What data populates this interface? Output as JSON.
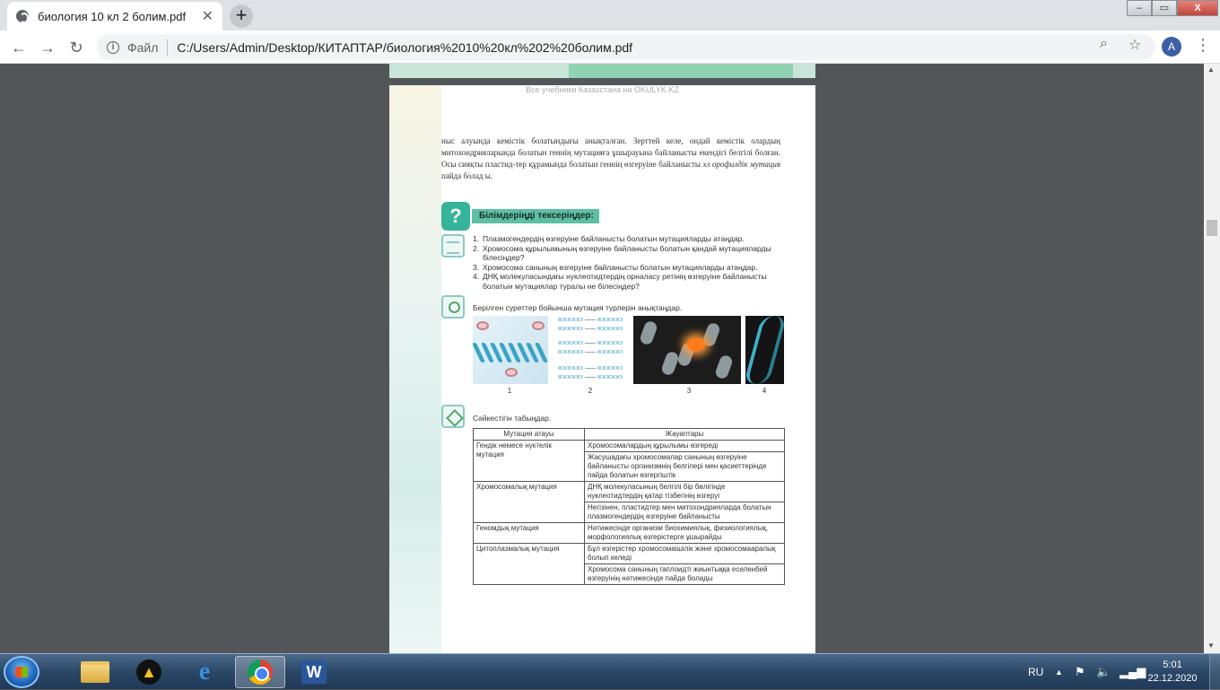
{
  "browser": {
    "tab_title": "биология 10 кл 2 болим.pdf",
    "tab_close": "✕",
    "new_tab": "+",
    "url_scheme": "Файл",
    "url": "C:/Users/Admin/Desktop/КИТАПТАР/биология%2010%20кл%202%20болим.pdf",
    "avatar_letter": "A",
    "window_controls": [
      "–",
      "▭",
      "X"
    ]
  },
  "pdf": {
    "watermark": "Все учебники Казахстана на OKULYK.KZ",
    "paragraph_part1": "ныс алуында кемістік болатындығы анықталған. Зерттей келе, ондай кемістік олардың митохондрияларында болатын геннің мутацияға ұшырауына байланысты екендігі белгілі болған. Осы сияқты пластид-тер құрамында болатын геннің өзгеруіне байланысты",
    "paragraph_italic": "хл орофилдік мутация",
    "paragraph_part2": "пайда болад ы.",
    "check_title": "Білімдеріңді тексеріңдер:",
    "questions": [
      {
        "num": "1.",
        "text": "Плазмогендердің өзгеруіне байланысты болатын мутацияларды атаңдар."
      },
      {
        "num": "2.",
        "text": "Хромосома құрылымының өзгеруіне байланысты болатын қандай мутацияларды білесіңдер?"
      },
      {
        "num": "3.",
        "text": "Хромосома санының өзгеруіне байланысты болатын мутацияларды атаңдар."
      },
      {
        "num": "4.",
        "text": "ДНҚ молекуласындағы нуклеотидтердің орналасу ретінің өзгеруіне байланысты болатын мутациялар туралы не білесіңдер?"
      }
    ],
    "image_instruction": "Берілген суреттер бойынша мутация түрлерін анықтаңдар.",
    "image_labels": [
      "1",
      "2",
      "3",
      "4"
    ],
    "match_instruction": "Сәйкестігін табыңдар.",
    "table_headers": [
      "Мутация атауы",
      "Жауаптары"
    ],
    "table_rows": [
      {
        "name": "Гендік немесе нүктелік мутация",
        "answers": [
          "Хромосомалардың құрылымы өзгереді",
          "Жасушадағы хромосомалар санының өзгеруіне байланысты организмнің белгілері мен қасиеттерінде пайда болатын өзгергіштік"
        ]
      },
      {
        "name": "Хромосомалық мутация",
        "answers": [
          "ДНҚ молекуласының белгілі бір бөлігінде нуклеотидтердің қатар тізбегінің өзгеруі",
          "Негізінен, пластидтер мен митохондрияларда болатын плазмогендердің өзгеруіне байланысты"
        ]
      },
      {
        "name": "Геномдық мутация",
        "answers": [
          "Нәтижесінде организм биохимиялық, физиологиялық, морфологиялық өзгерістерге ұшырайды"
        ]
      },
      {
        "name": "Цитоплазмалық мутация",
        "answers": [
          "Бұл өзгерістер хромосомаішілік және хромосомааралық болып келеді",
          "Хромосома санының гаплоидті жиынтыққа еселенбей өзгеруінің нәтижесінде пайда болады"
        ]
      }
    ]
  },
  "taskbar": {
    "lang": "RU",
    "time": "5:01",
    "date": "22.12.2020",
    "apps": [
      "explorer",
      "avast",
      "internet-explorer",
      "chrome",
      "word"
    ]
  }
}
